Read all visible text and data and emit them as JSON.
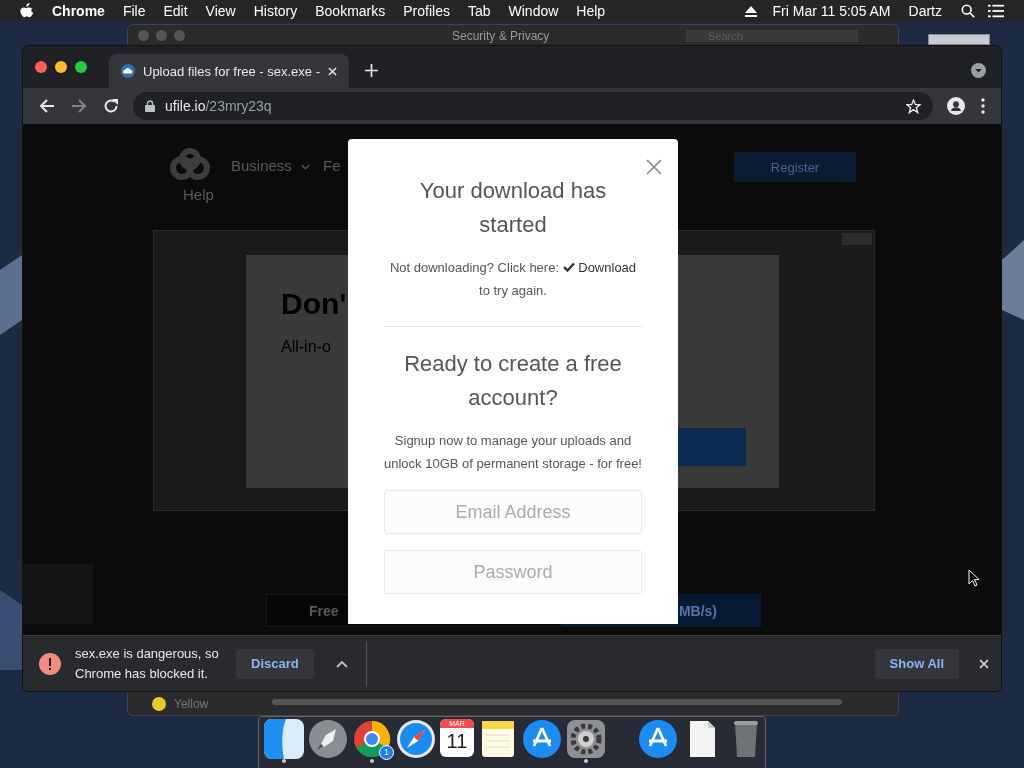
{
  "menu_bar": {
    "app_name": "Chrome",
    "menus": [
      "File",
      "Edit",
      "View",
      "History",
      "Bookmarks",
      "Profiles",
      "Tab",
      "Window",
      "Help"
    ],
    "clock": "Fri Mar 11 5:05 AM",
    "user": "Dartz"
  },
  "background_window": {
    "title": "Security & Privacy",
    "search_placeholder": "Search",
    "sidebar_item": "Yellow"
  },
  "browser": {
    "tab": {
      "title": "Upload files for free - sex.exe -",
      "selected": true
    },
    "address": {
      "domain": "ufile.io",
      "path": "/23mry23q"
    },
    "page": {
      "nav": [
        "Business",
        "Fe"
      ],
      "help": "Help",
      "register": "Register",
      "ad_heading": "Don'",
      "ad_text": "All-in-o",
      "free_button": "Free",
      "speed_button": "MB/s)"
    },
    "modal": {
      "title": "Your download has started",
      "retry_before": "Not downloading? Click here:",
      "retry_link": "Download",
      "retry_after": "to try again.",
      "signup_title": "Ready to create a free account?",
      "signup_text": "Signup now to manage your uploads and unlock 10GB of permanent storage - for free!",
      "email": {
        "placeholder": "Email Address"
      },
      "password": {
        "placeholder": "Password"
      }
    },
    "download_bar": {
      "message": "sex.exe is dangerous, so Chrome has blocked it.",
      "discard": "Discard",
      "show_all": "Show All"
    }
  },
  "dock": {
    "items": [
      {
        "kind": "finder",
        "running": true
      },
      {
        "kind": "launchpad",
        "running": false
      },
      {
        "kind": "chrome",
        "running": true,
        "badge": "1"
      },
      {
        "kind": "safari",
        "running": false
      },
      {
        "kind": "calendar",
        "running": false,
        "month": "MAR",
        "day": "11"
      },
      {
        "kind": "notes",
        "running": false
      },
      {
        "kind": "appstore",
        "running": false
      },
      {
        "kind": "settings",
        "running": true
      },
      {
        "kind": "separator"
      },
      {
        "kind": "downloads",
        "running": false
      },
      {
        "kind": "document",
        "running": false
      },
      {
        "kind": "trash",
        "running": false
      }
    ]
  }
}
